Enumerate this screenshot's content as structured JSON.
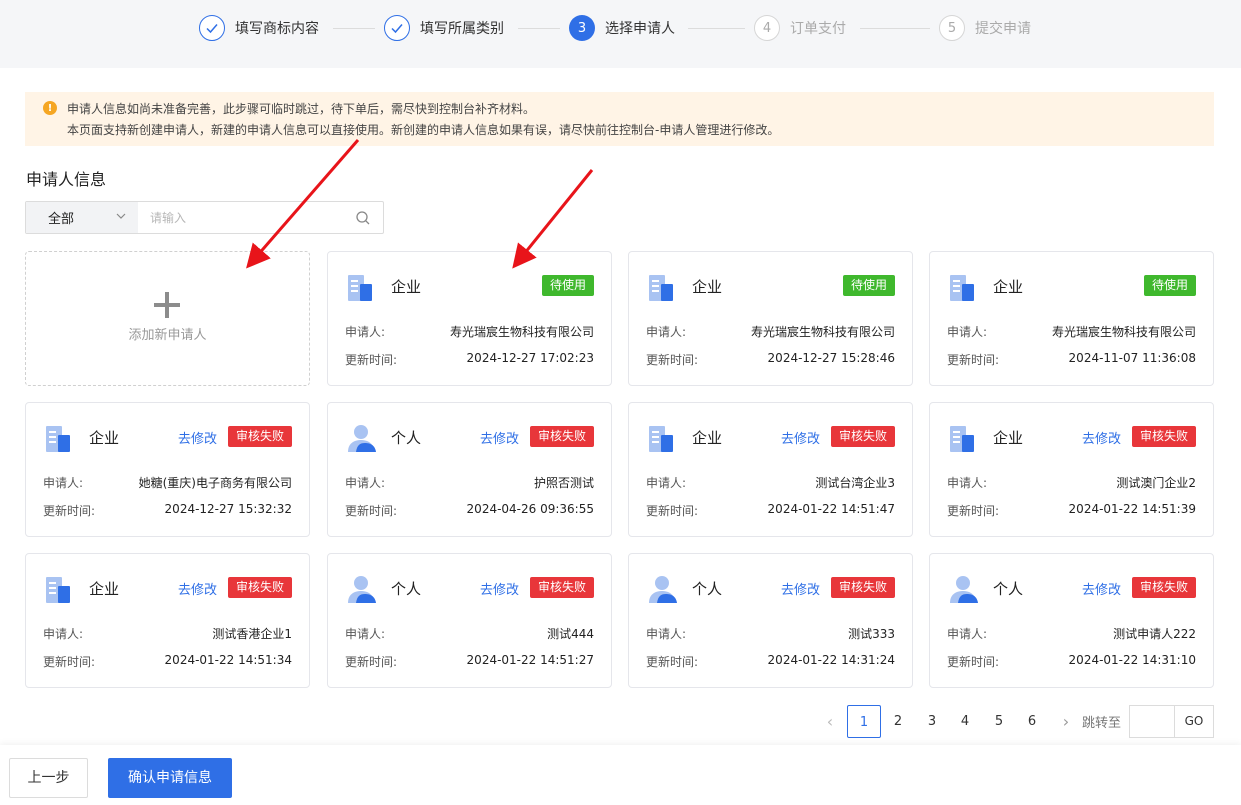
{
  "steps": [
    {
      "label": "填写商标内容",
      "state": "done",
      "num": ""
    },
    {
      "label": "填写所属类别",
      "state": "done",
      "num": ""
    },
    {
      "label": "选择申请人",
      "state": "active",
      "num": "3"
    },
    {
      "label": "订单支付",
      "state": "todo",
      "num": "4"
    },
    {
      "label": "提交申请",
      "state": "todo",
      "num": "5"
    }
  ],
  "notice": {
    "line1": "申请人信息如尚未准备完善，此步骤可临时跳过，待下单后，需尽快到控制台补齐材料。",
    "line2": "本页面支持新创建申请人，新建的申请人信息可以直接使用。新创建的申请人信息如果有误，请尽快前往控制台-申请人管理进行修改。"
  },
  "section_title": "申请人信息",
  "search": {
    "filter": "全部",
    "placeholder": "请输入"
  },
  "add_card": {
    "label": "添加新申请人"
  },
  "card_labels": {
    "applicant": "申请人:",
    "updated": "更新时间:",
    "edit": "去修改"
  },
  "cards": [
    {
      "type": "企业",
      "icon": "building-icon",
      "status": "待使用",
      "status_color": "green",
      "editable": false,
      "applicant": "寿光瑞宸生物科技有限公司",
      "updated": "2024-12-27 17:02:23"
    },
    {
      "type": "企业",
      "icon": "building-icon",
      "status": "待使用",
      "status_color": "green",
      "editable": false,
      "applicant": "寿光瑞宸生物科技有限公司",
      "updated": "2024-12-27 15:28:46"
    },
    {
      "type": "企业",
      "icon": "building-icon",
      "status": "待使用",
      "status_color": "green",
      "editable": false,
      "applicant": "寿光瑞宸生物科技有限公司",
      "updated": "2024-11-07 11:36:08"
    },
    {
      "type": "企业",
      "icon": "building-icon",
      "status": "审核失败",
      "status_color": "red",
      "editable": true,
      "applicant": "她糖(重庆)电子商务有限公司",
      "updated": "2024-12-27 15:32:32"
    },
    {
      "type": "个人",
      "icon": "person-icon",
      "status": "审核失败",
      "status_color": "red",
      "editable": true,
      "applicant": "护照否测试",
      "updated": "2024-04-26 09:36:55"
    },
    {
      "type": "企业",
      "icon": "building-icon",
      "status": "审核失败",
      "status_color": "red",
      "editable": true,
      "applicant": "测试台湾企业3",
      "updated": "2024-01-22 14:51:47"
    },
    {
      "type": "企业",
      "icon": "building-icon",
      "status": "审核失败",
      "status_color": "red",
      "editable": true,
      "applicant": "测试澳门企业2",
      "updated": "2024-01-22 14:51:39"
    },
    {
      "type": "企业",
      "icon": "building-icon",
      "status": "审核失败",
      "status_color": "red",
      "editable": true,
      "applicant": "测试香港企业1",
      "updated": "2024-01-22 14:51:34"
    },
    {
      "type": "个人",
      "icon": "person-icon",
      "status": "审核失败",
      "status_color": "red",
      "editable": true,
      "applicant": "测试444",
      "updated": "2024-01-22 14:51:27"
    },
    {
      "type": "个人",
      "icon": "person-icon",
      "status": "审核失败",
      "status_color": "red",
      "editable": true,
      "applicant": "测试333",
      "updated": "2024-01-22 14:31:24"
    },
    {
      "type": "个人",
      "icon": "person-icon",
      "status": "审核失败",
      "status_color": "red",
      "editable": true,
      "applicant": "测试申请人222",
      "updated": "2024-01-22 14:31:10"
    }
  ],
  "pagination": {
    "pages": [
      "1",
      "2",
      "3",
      "4",
      "5",
      "6"
    ],
    "current": "1",
    "jump_label": "跳转至",
    "go": "GO"
  },
  "footer": {
    "prev": "上一步",
    "confirm": "确认申请信息"
  },
  "colors": {
    "primary": "#2f6fe6",
    "success": "#3fb82d",
    "danger": "#e8363a",
    "warning_bg": "#fff4e6",
    "annotation": "#e8141a"
  }
}
